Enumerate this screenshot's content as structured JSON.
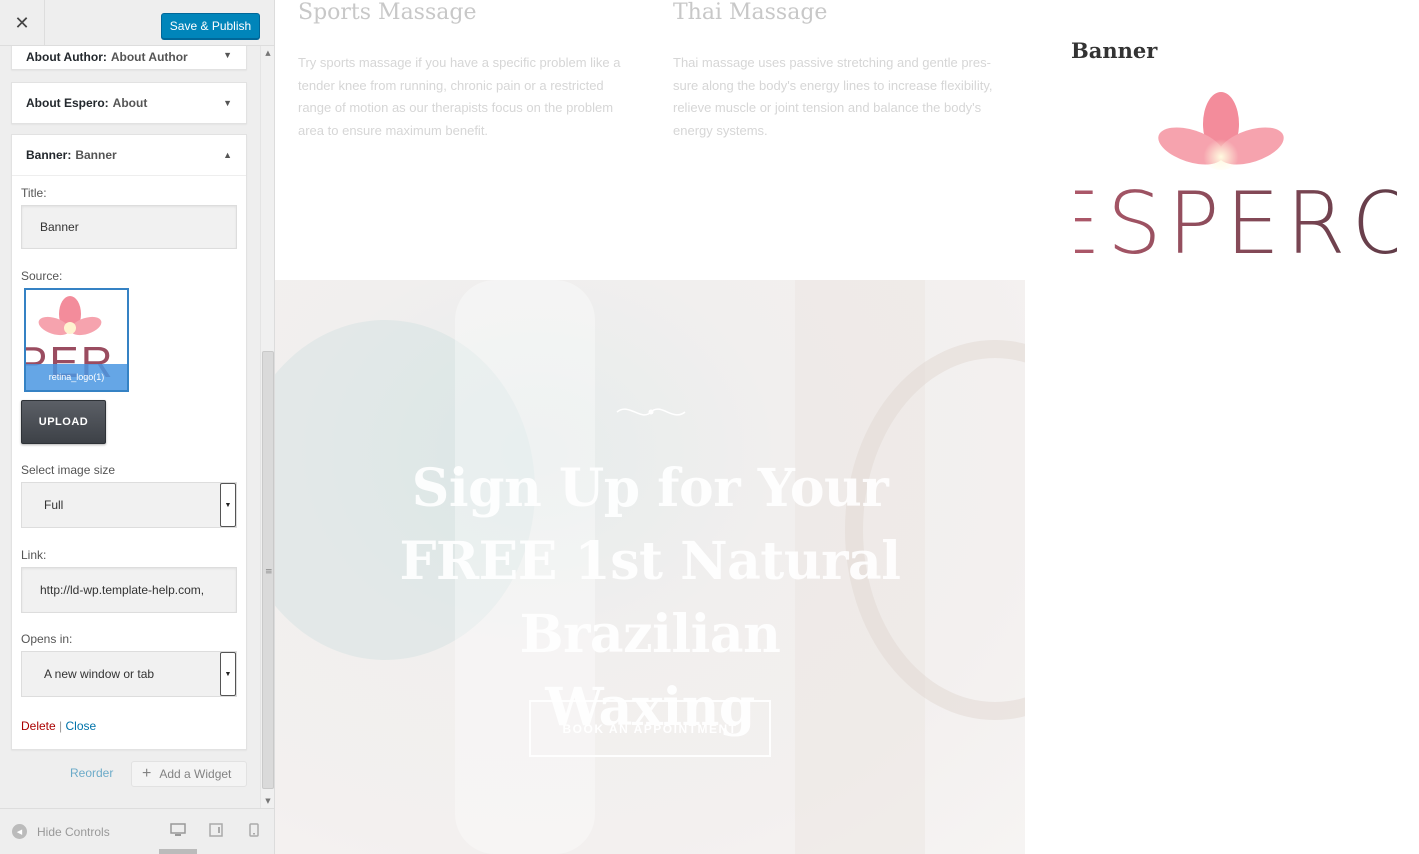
{
  "customizer": {
    "close_glyph": "✕",
    "save_label": "Save & Publish",
    "widgets": [
      {
        "type": "About Author:",
        "title": "About Author"
      },
      {
        "type": "About Espero:",
        "title": "About"
      },
      {
        "type": "Banner:",
        "title": "Banner"
      }
    ],
    "form": {
      "title_label": "Title:",
      "title_value": "Banner",
      "source_label": "Source:",
      "thumb_caption": "retina_logo(1)",
      "thumb_text": "PER",
      "upload_label": "UPLOAD",
      "size_label": "Select image size",
      "size_value": "Full",
      "link_label": "Link:",
      "link_value": "http://ld-wp.template-help.com,",
      "opens_label": "Opens in:",
      "opens_value": "A new window or tab",
      "delete_label": "Delete",
      "separator": " | ",
      "close_label": "Close"
    },
    "reorder_label": "Reorder",
    "add_widget_label": "Add a Widget",
    "hide_controls_label": "Hide Controls"
  },
  "preview": {
    "services": [
      {
        "title": "Sports Massage",
        "text": "Try sports massage if you have a specific problem like a tender knee from running, chronic pain or a restricted range of motion as our therapists focus on the problem area to ensure maximum benefit."
      },
      {
        "title": "Thai Massage",
        "text": "Thai massage uses passive stretching and gentle pres- sure along the body's energy lines to increase flexibility, relieve muscle or joint tension and balance the body's energy systems."
      }
    ],
    "hero": {
      "line1": "Sign Up for Your",
      "line2": "FREE 1st Natural Brazilian",
      "line3": "Waxing",
      "button": "BOOK AN APPOINTMENT"
    },
    "banner": {
      "title": "Banner",
      "logo_text": "ESPERO"
    }
  },
  "colors": {
    "save_blue": "#0085ba",
    "petal_pink": "#f38c9b",
    "logo_plum": "#8e4a5c",
    "link_blue": "#0073aa",
    "delete_red": "#aa0000"
  }
}
